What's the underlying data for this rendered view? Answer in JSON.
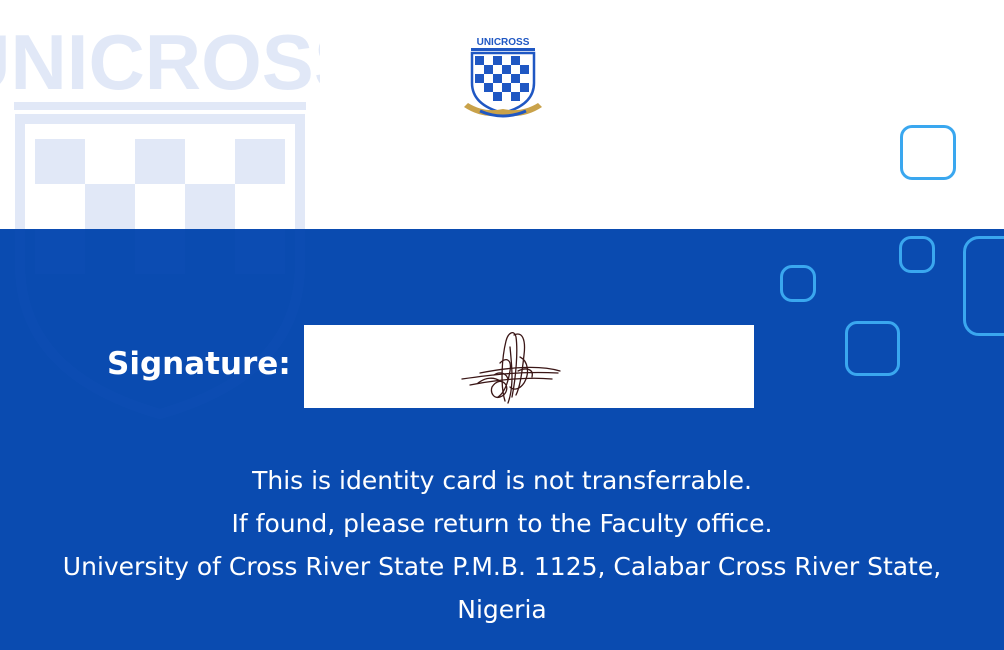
{
  "logo": {
    "name": "unicross-crest-logo",
    "text": "UNICROSS",
    "colors": {
      "blue": "#1f57c3",
      "light": "#ffffff",
      "gold": "#c9a24a"
    }
  },
  "watermark": {
    "text": "UNICROSS"
  },
  "colors": {
    "band": "#0a4bb0",
    "accent": "#3aa7ef",
    "top": "#ffffff"
  },
  "signature": {
    "label": "Signature:"
  },
  "footer": {
    "line1": "This is identity card is not transferrable.",
    "line2": "If found, please return to the Faculty office.",
    "line3": "University of Cross River State P.M.B. 1125, Calabar Cross River State, Nigeria"
  }
}
